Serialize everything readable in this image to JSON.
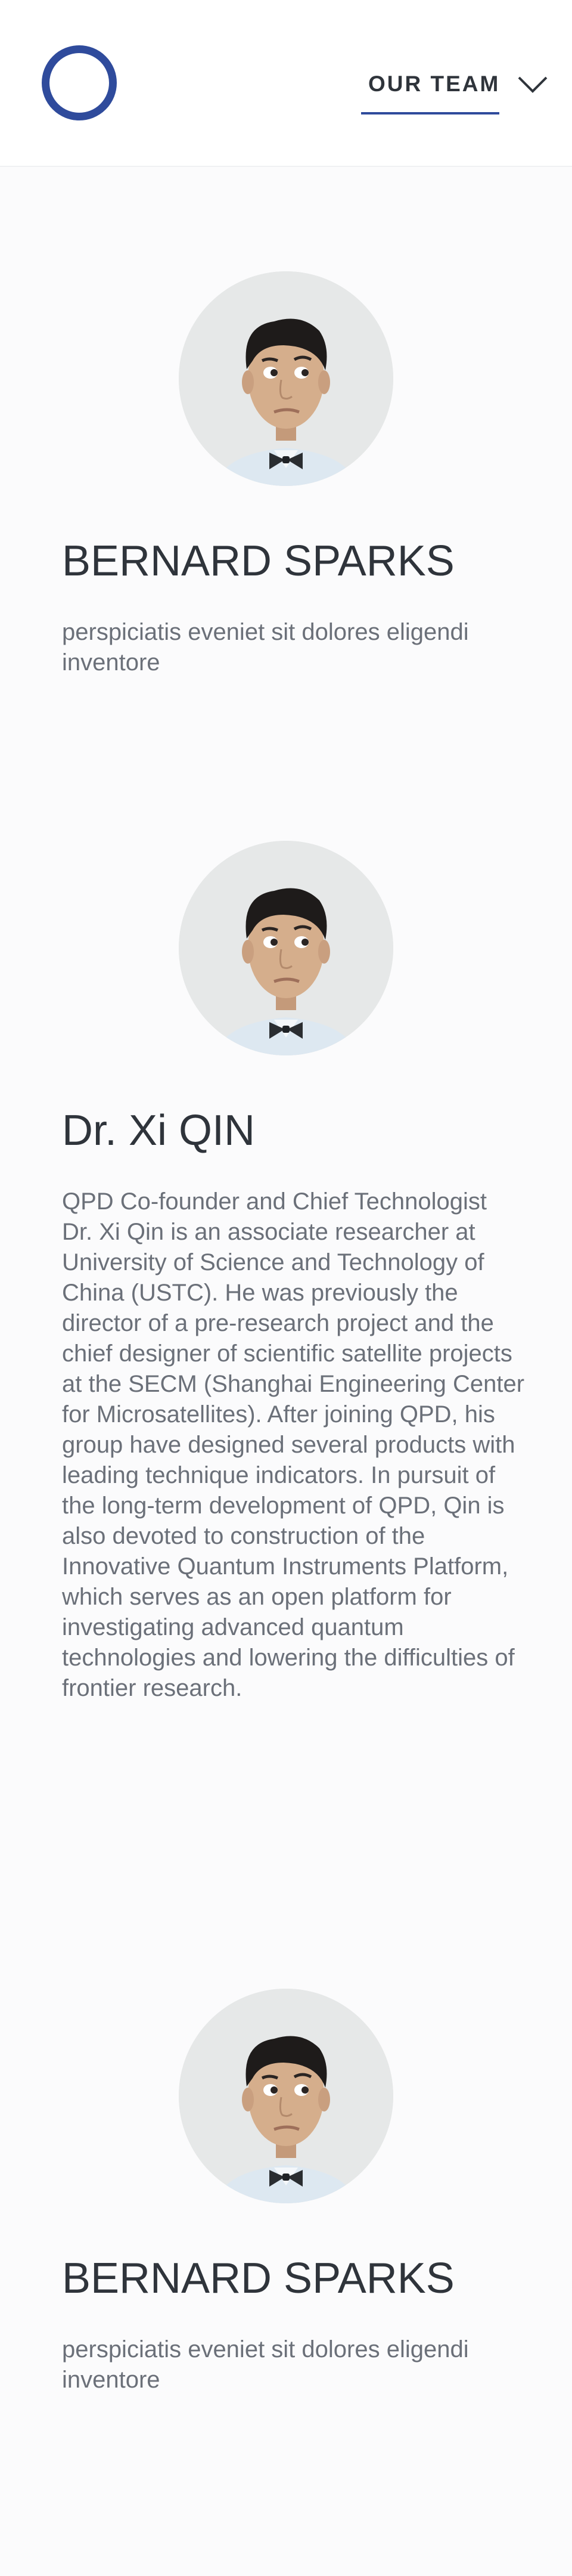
{
  "header": {
    "logo": "ring-logo",
    "nav_label": "OUR TEAM",
    "menu_icon": "chevron-down-icon",
    "accent_color": "#2f4b9c"
  },
  "members": [
    {
      "name": "BERNARD SPARKS",
      "description": "perspiciatis eveniet sit dolores eligendi inventore"
    },
    {
      "name": "Dr. Xi QIN",
      "description": "QPD Co-founder and Chief Technologist\nDr. Xi Qin is an associate researcher at University of Science and Technology of China (USTC). He was previously the director of a pre-research project and the chief designer of scientific satellite projects at the SECM (Shanghai Engineering Center for Microsatellites). After joining QPD, his group have designed several products with leading technique indicators. In pursuit of the long-term development of QPD, Qin is also devoted to construction of the Innovative Quantum Instruments Platform, which serves as an open platform for investigating advanced quantum technologies and lowering the difficulties of frontier research."
    },
    {
      "name": "BERNARD SPARKS",
      "description": "perspiciatis eveniet sit dolores eligendi inventore"
    }
  ]
}
